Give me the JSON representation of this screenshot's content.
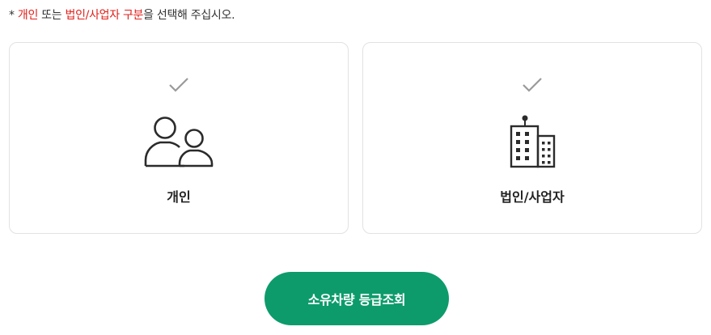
{
  "notice": {
    "prefix": "* ",
    "opt_personal": "개인",
    "sep_1": " 또는 ",
    "opt_corporate": "법인/사업자 구분",
    "suffix": "을 선택해 주십시오."
  },
  "options": [
    {
      "label": "개인",
      "icon": "people-icon",
      "selected": false
    },
    {
      "label": "법인/사업자",
      "icon": "building-icon",
      "selected": false
    }
  ],
  "submit": {
    "label": "소유차량 등급조회"
  },
  "colors": {
    "accent_red": "#e0201b",
    "button_green": "#0d9b6c",
    "check_gray": "#9a9a9a",
    "icon_dark": "#2b2b2b",
    "border": "#e2e2e2"
  }
}
